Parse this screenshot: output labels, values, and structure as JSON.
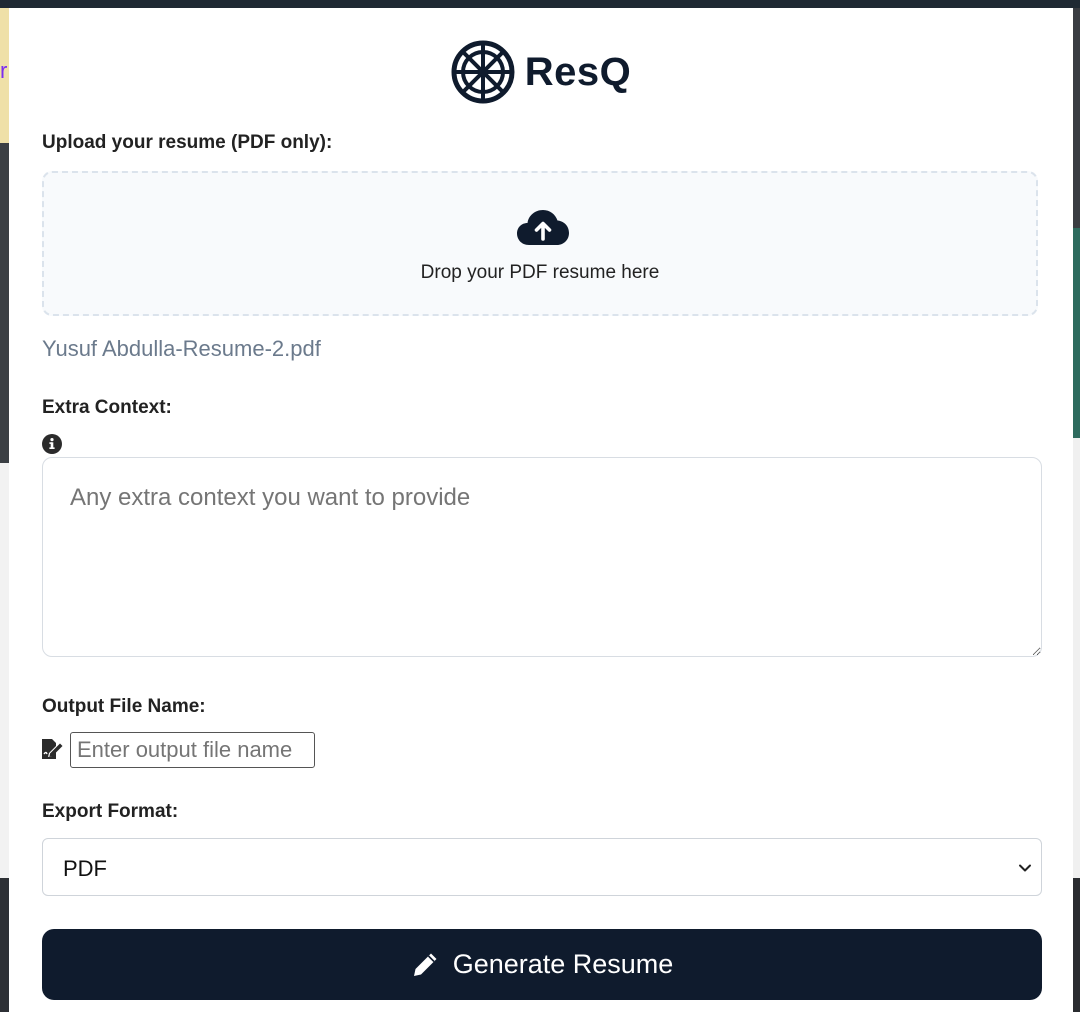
{
  "app": {
    "name": "ResQ",
    "logo_icon": "ship-wheel-icon",
    "brand_color": "#0f1b2d"
  },
  "upload": {
    "label": "Upload your resume (PDF only):",
    "dropzone_text": "Drop your PDF resume here",
    "icon": "cloud-upload-icon",
    "selected_file": "Yusuf Abdulla-Resume-2.pdf"
  },
  "context": {
    "label": "Extra Context:",
    "info_icon": "info-icon",
    "placeholder": "Any extra context you want to provide",
    "value": ""
  },
  "output": {
    "label": "Output File Name:",
    "icon": "file-signature-icon",
    "placeholder": "Enter output file name",
    "value": ""
  },
  "export": {
    "label": "Export Format:",
    "selected": "PDF"
  },
  "generate": {
    "label": "Generate Resume",
    "icon": "pencil-icon"
  }
}
